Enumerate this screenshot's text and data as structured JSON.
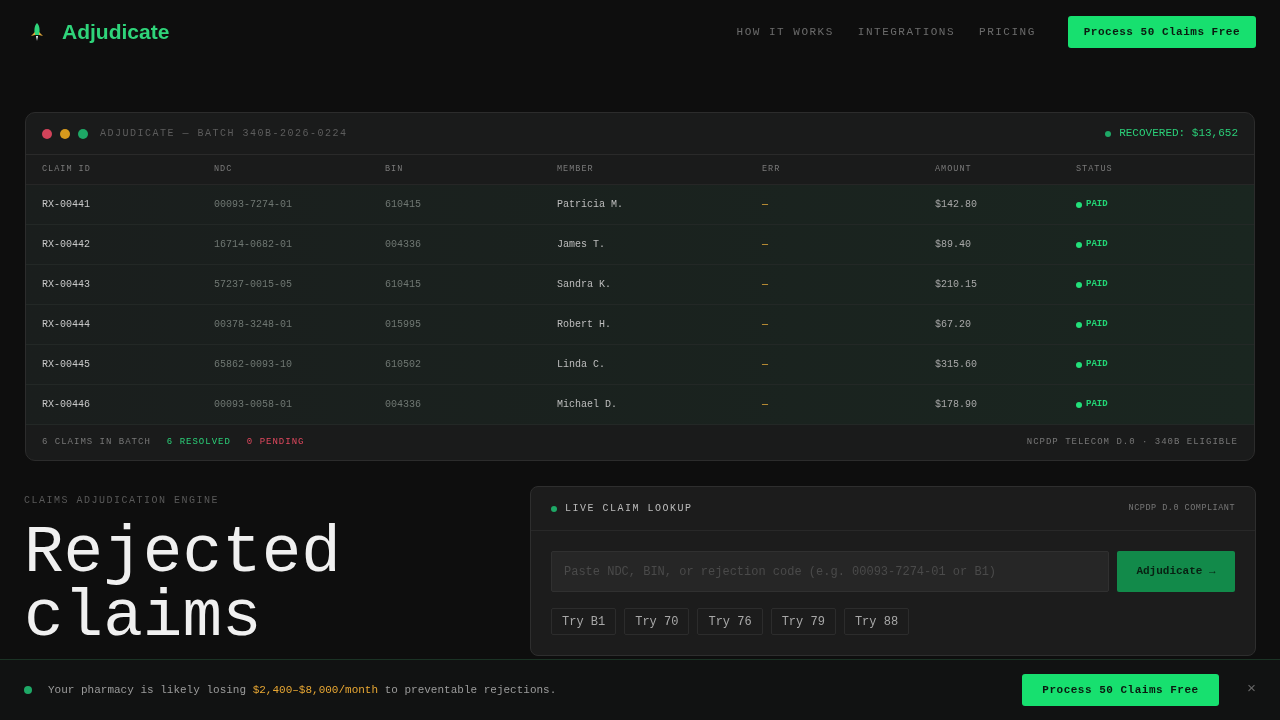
{
  "brand": {
    "name": "Adjudicate"
  },
  "nav": {
    "links": [
      "HOW IT WORKS",
      "INTEGRATIONS",
      "PRICING"
    ],
    "cta": "Process 50 Claims Free"
  },
  "terminal": {
    "title": "ADJUDICATE — BATCH 340B-2026-0224",
    "recovered": "RECOVERED: $13,652",
    "columns": [
      "CLAIM ID",
      "NDC",
      "BIN",
      "MEMBER",
      "ERR",
      "AMOUNT",
      "STATUS"
    ],
    "rows": [
      {
        "claim_id": "RX-00441",
        "ndc": "00093-7274-01",
        "bin": "610415",
        "member": "Patricia M.",
        "err": "—",
        "amount": "$142.80",
        "status": {
          "label": "PAID",
          "color": "#22e07a"
        }
      },
      {
        "claim_id": "RX-00442",
        "ndc": "16714-0682-01",
        "bin": "004336",
        "member": "James T.",
        "err": "—",
        "amount": "$89.40",
        "status": {
          "label": "PAID",
          "color": "#22e07a"
        }
      },
      {
        "claim_id": "RX-00443",
        "ndc": "57237-0015-05",
        "bin": "610415",
        "member": "Sandra K.",
        "err": "—",
        "amount": "$210.15",
        "status": {
          "label": "PAID",
          "color": "#22e07a"
        }
      },
      {
        "claim_id": "RX-00444",
        "ndc": "00378-3248-01",
        "bin": "015995",
        "member": "Robert H.",
        "err": "—",
        "amount": "$67.20",
        "status": {
          "label": "PAID",
          "color": "#22e07a"
        }
      },
      {
        "claim_id": "RX-00445",
        "ndc": "65862-0093-10",
        "bin": "610502",
        "member": "Linda C.",
        "err": "—",
        "amount": "$315.60",
        "status": {
          "label": "PAID",
          "color": "#22e07a"
        }
      },
      {
        "claim_id": "RX-00446",
        "ndc": "00093-0058-01",
        "bin": "004336",
        "member": "Michael D.",
        "err": "—",
        "amount": "$178.90",
        "status": {
          "label": "PAID",
          "color": "#22e07a"
        }
      }
    ],
    "footer": {
      "count": "6 CLAIMS IN BATCH",
      "resolved": "6 RESOLVED",
      "pending": "0 PENDING",
      "standard": "NCPDP TELECOM D.0 · 340B ELIGIBLE"
    }
  },
  "hero": {
    "eyebrow": "CLAIMS ADJUDICATION ENGINE",
    "headline": [
      "Rejected",
      "claims"
    ]
  },
  "lookup": {
    "title": "LIVE CLAIM LOOKUP",
    "compliance": "NCPDP D.0 COMPLIANT",
    "placeholder": "Paste NDC, BIN, or rejection code (e.g. 00093-7274-01 or B1)",
    "button": "Adjudicate →",
    "tries": [
      "Try B1",
      "Try 70",
      "Try 76",
      "Try 79",
      "Try 88"
    ]
  },
  "banner": {
    "message": "Your pharmacy is likely losing **$2,400–$8,000/month** to preventable rejections.",
    "cta": "Process 50 Claims Free",
    "close": "×"
  }
}
